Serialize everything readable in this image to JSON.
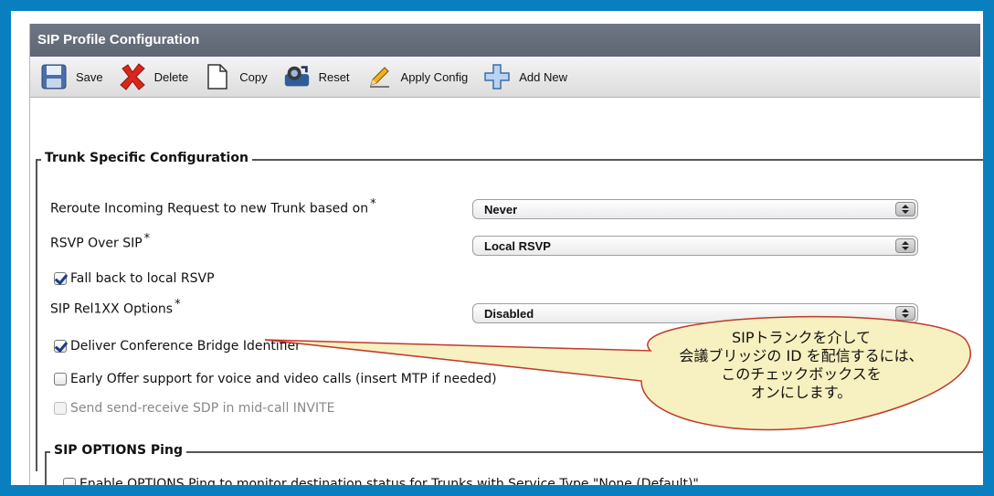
{
  "header": {
    "title": "SIP Profile Configuration"
  },
  "toolbar": {
    "save": "Save",
    "delete": "Delete",
    "copy": "Copy",
    "reset": "Reset",
    "apply_config": "Apply Config",
    "add_new": "Add New"
  },
  "trunk_section": {
    "legend": "Trunk Specific Configuration",
    "reroute_label": "Reroute Incoming Request to new Trunk based on",
    "reroute_value": "Never",
    "rsvp_label": "RSVP Over SIP",
    "rsvp_value": "Local RSVP",
    "fallback_label": "Fall back to local RSVP",
    "rel1xx_label": "SIP Rel1XX Options",
    "rel1xx_value": "Disabled",
    "deliver_label": "Deliver Conference Bridge Identifier",
    "early_offer_label": "Early Offer support for voice and video calls (insert MTP if needed)",
    "send_receive_label": "Send send-receive SDP in mid-call INVITE",
    "required_mark": "*"
  },
  "options_section": {
    "legend": "SIP OPTIONS Ping",
    "enable_label": "Enable OPTIONS Ping to monitor destination status for Trunks with Service Type \"None (Default)\""
  },
  "callout": {
    "line1": "SIPトランクを介して",
    "line2": "会議ブリッジの ID を配信するには、",
    "line3": "このチェックボックスを",
    "line4": "オンにします。"
  },
  "colors": {
    "border_blue": "#0a7fc0",
    "title_bar": "#636a78",
    "callout_fill": "#f7f0c0",
    "callout_stroke": "#c0392b"
  }
}
